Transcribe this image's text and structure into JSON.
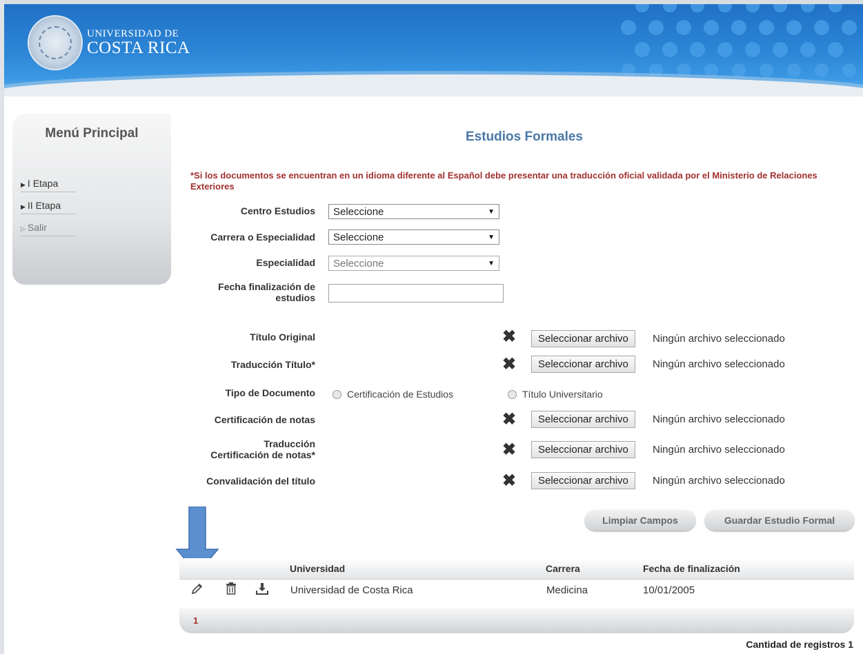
{
  "header": {
    "logo_line1": "UNIVERSIDAD DE",
    "logo_line2": "COSTA RICA",
    "brand_colors": {
      "blue": "#2d86d6",
      "title": "#4a78a6",
      "warning": "#a0312f"
    }
  },
  "sidebar": {
    "title": "Menú Principal",
    "items": [
      {
        "label": "I Etapa"
      },
      {
        "label": "II Etapa"
      },
      {
        "label": "Salir"
      }
    ]
  },
  "main": {
    "title": "Estudios Formales",
    "warning": "*Si los documentos se encuentran en un idioma diferente al Español debe presentar una traducción oficial validada por el Ministerio de Relaciones Exteriores",
    "fields": {
      "centro_label": "Centro Estudios",
      "centro_value": "Seleccione",
      "carrera_label": "Carrera o Especialidad",
      "carrera_value": "Seleccione",
      "especialidad_label": "Especialidad",
      "especialidad_value": "Seleccione",
      "fecha_label_1": "Fecha finalización de",
      "fecha_label_2": "estudios",
      "fecha_value": ""
    },
    "files": {
      "button_label": "Seleccionar archivo",
      "status": "Ningún archivo seleccionado",
      "titulo_original": "Título Original",
      "traduccion_titulo": "Traducción Título*",
      "cert_notas": "Certificación de notas",
      "trad_cert_1": "Traducción",
      "trad_cert_2": "Certificación de notas*",
      "convalidacion": "Convalidación del título"
    },
    "tipo_documento": {
      "label": "Tipo de Documento",
      "options": [
        "Certificación de Estudios",
        "Título Universitario"
      ]
    },
    "buttons": {
      "clear": "Limpiar Campos",
      "save": "Guardar Estudio Formal"
    }
  },
  "table": {
    "columns": [
      "Universidad",
      "Carrera",
      "Fecha de finalización"
    ],
    "rows": [
      {
        "universidad": "Universidad de Costa Rica",
        "carrera": "Medicina",
        "fecha": "10/01/2005"
      }
    ],
    "page": "1",
    "count_label": "Cantidad de registros 1"
  }
}
